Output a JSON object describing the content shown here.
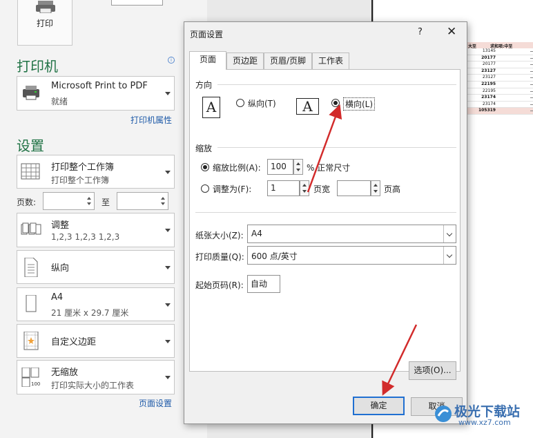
{
  "backstage": {
    "print_label": "打印",
    "printer_title": "打印机",
    "printer_name": "Microsoft Print to PDF",
    "printer_status": "就绪",
    "printer_props_link": "打印机属性",
    "settings_title": "设置",
    "scope_main": "打印整个工作簿",
    "scope_sub": "打印整个工作簿",
    "pages_label": "页数:",
    "pages_to": "至",
    "collate_main": "调整",
    "collate_sub": "1,2,3    1,2,3    1,2,3",
    "orientation": "纵向",
    "paper_main": "A4",
    "paper_sub": "21 厘米 x 29.7 厘米",
    "margins": "自定义边距",
    "scaling_main": "无缩放",
    "scaling_sub": "打印实际大小的工作表",
    "page_setup_link": "页面设置"
  },
  "dialog": {
    "title": "页面设置",
    "help": "?",
    "close": "✕",
    "tabs": [
      "页面",
      "页边距",
      "页眉/页脚",
      "工作表"
    ],
    "orientation_group": "方向",
    "portrait_label": "纵向(T)",
    "landscape_label": "横向(L)",
    "orient_glyph": "A",
    "scaling_group": "缩放",
    "scale_label": "缩放比例(A):",
    "scale_value": "100",
    "scale_suffix": "% 正常尺寸",
    "fit_label": "调整为(F):",
    "fit_wide_value": "1",
    "fit_wide_suffix": "页宽",
    "fit_tall_value": "",
    "fit_tall_suffix": "页高",
    "paper_size_label": "纸张大小(Z):",
    "paper_size_value": "A4",
    "print_quality_label": "打印质量(Q):",
    "print_quality_value": "600 点/英寸",
    "first_page_label": "起始页码(R):",
    "first_page_value": "自动",
    "options_button": "选项(O)...",
    "ok_button": "确定",
    "cancel_button": "取消"
  },
  "preview": {
    "header_cells": [
      "大至",
      "求和项:中至"
    ],
    "values": [
      "13145",
      "20177",
      "20177",
      "23127",
      "23127",
      "22195",
      "22195",
      "23174",
      "23174",
      "105319"
    ]
  },
  "watermark": {
    "brand": "极光下载站",
    "url": "www.xz7.com"
  },
  "colors": {
    "accent_green": "#217346",
    "link_blue": "#1e5aa8",
    "arrow_red": "#d22b2b",
    "default_button_border": "#1f6fd1"
  }
}
